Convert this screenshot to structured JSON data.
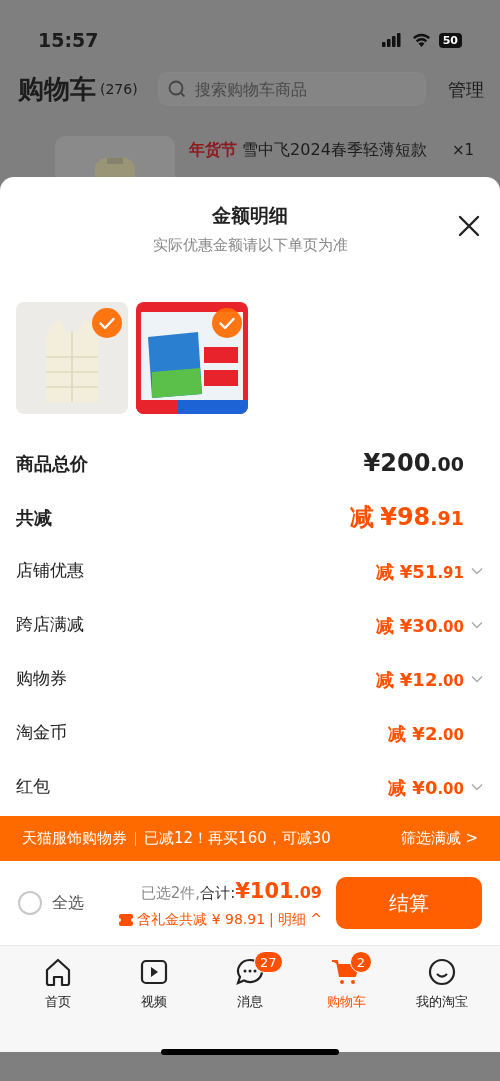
{
  "status_bar": {
    "time": "15:57",
    "battery": "50"
  },
  "cart_header": {
    "title": "购物车",
    "count": "(276)",
    "search": {
      "placeholder": "搜索购物车商品"
    },
    "manage": "管理"
  },
  "cart_item": {
    "tag": "年货节",
    "title": "雪中飞2024春季轻薄短款",
    "quantity": "×1"
  },
  "sheet": {
    "title": "金额明细",
    "subtitle": "实际优惠金额请以下单页为准",
    "products": [
      {
        "selected": true
      },
      {
        "selected": true
      }
    ],
    "rows": [
      {
        "kind": "total",
        "label": "商品总价",
        "prefix": "",
        "amount_main": "¥200",
        "amount_cents": ".00"
      },
      {
        "kind": "discount_total",
        "label": "共减",
        "prefix": "减",
        "amount_main": "¥98",
        "amount_cents": ".91"
      },
      {
        "kind": "discount",
        "label": "店铺优惠",
        "prefix": "减",
        "amount_main": "¥51",
        "amount_cents": ".91",
        "expandable": true
      },
      {
        "kind": "discount",
        "label": "跨店满减",
        "prefix": "减",
        "amount_main": "¥30",
        "amount_cents": ".00",
        "expandable": true
      },
      {
        "kind": "discount",
        "label": "购物券",
        "prefix": "减",
        "amount_main": "¥12",
        "amount_cents": ".00",
        "expandable": true
      },
      {
        "kind": "discount",
        "label": "淘金币",
        "prefix": "减",
        "amount_main": "¥2",
        "amount_cents": ".00",
        "expandable": false
      },
      {
        "kind": "discount",
        "label": "红包",
        "prefix": "减",
        "amount_main": "¥0",
        "amount_cents": ".00",
        "expandable": true
      }
    ]
  },
  "promo_banner": {
    "coupon": "天猫服饰购物券",
    "message": "已减12！再买160，可减30",
    "action": "筛选满减 >"
  },
  "checkout_bar": {
    "select_all": {
      "label": "全选",
      "checked": false
    },
    "selected_count": "已选2件,",
    "total_label": "合计:",
    "total_main": "¥101",
    "total_cents": ".09",
    "discount_note": "含礼金共减 ¥ 98.91",
    "separator": "|",
    "detail_link": "明细 ^",
    "checkout_button": "结算"
  },
  "tab_bar": [
    {
      "kind": "home",
      "label": "首页",
      "selected": false
    },
    {
      "kind": "video",
      "label": "视频",
      "selected": false
    },
    {
      "kind": "message",
      "label": "消息",
      "badge": "27",
      "selected": false
    },
    {
      "kind": "cart",
      "label": "购物车",
      "badge": "2",
      "selected": true
    },
    {
      "kind": "profile",
      "label": "我的淘宝",
      "selected": false
    }
  ]
}
